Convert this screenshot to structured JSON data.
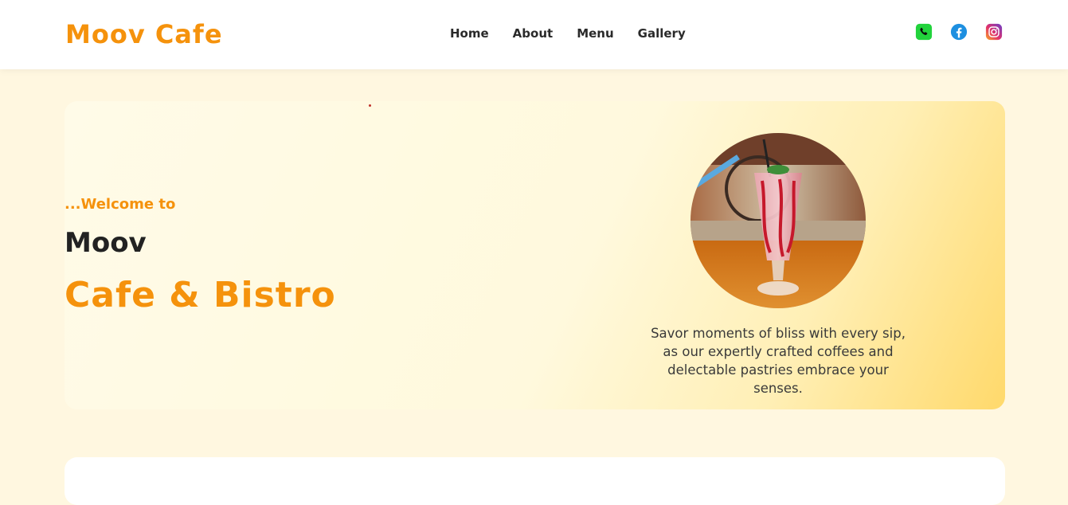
{
  "brand": {
    "name": "Moov Cafe"
  },
  "nav": {
    "items": [
      {
        "label": "Home"
      },
      {
        "label": "About"
      },
      {
        "label": "Menu"
      },
      {
        "label": "Gallery"
      }
    ]
  },
  "socials": [
    {
      "icon": "whatsapp-icon",
      "color": "#25d366"
    },
    {
      "icon": "facebook-icon",
      "color": "#1877f2"
    },
    {
      "icon": "instagram-icon",
      "color": "#c13584"
    }
  ],
  "hero": {
    "welcome": "...Welcome to",
    "title": "Moov",
    "subtitle": "Cafe & Bistro",
    "tagline": "Savor moments of bliss with every sip, as our expertly crafted coffees and delectable pastries embrace your senses."
  },
  "colors": {
    "accent": "#f5920c",
    "background": "#fff7e0"
  }
}
